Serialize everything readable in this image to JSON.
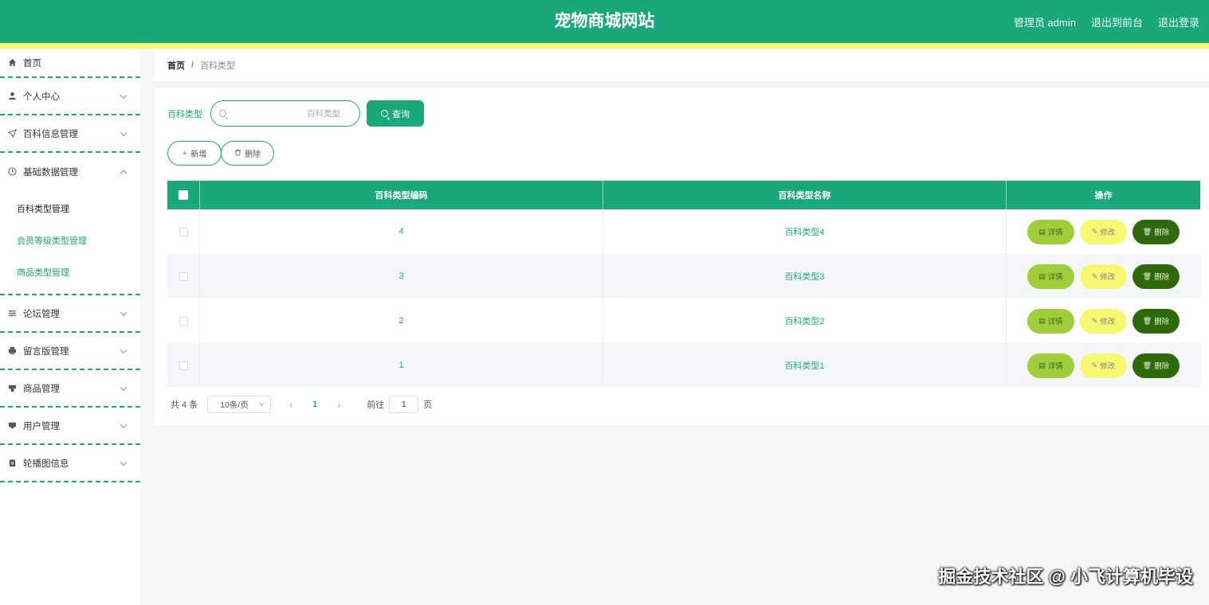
{
  "header": {
    "title": "宠物商城网站",
    "user_label": "管理员 admin",
    "front_link": "退出到前台",
    "logout_link": "退出登录"
  },
  "sidebar": {
    "items": [
      {
        "label": "首页",
        "icon": "home-icon"
      },
      {
        "label": "个人中心",
        "icon": "user-icon"
      },
      {
        "label": "百科信息管理",
        "icon": "send-icon"
      },
      {
        "label": "基础数据管理",
        "icon": "clock-icon",
        "expanded": true,
        "children": [
          "百科类型管理",
          "会员等级类型管理",
          "商品类型管理"
        ],
        "active_child": "百科类型管理"
      },
      {
        "label": "论坛管理",
        "icon": "sliders-icon"
      },
      {
        "label": "留言版管理",
        "icon": "printer-icon"
      },
      {
        "label": "商品管理",
        "icon": "shop-icon"
      },
      {
        "label": "用户管理",
        "icon": "monitor-icon"
      },
      {
        "label": "轮播图信息",
        "icon": "clipboard-icon"
      }
    ]
  },
  "breadcrumb": {
    "home": "首页",
    "separator": "/",
    "current": "百科类型"
  },
  "search": {
    "label": "百科类型",
    "placeholder": "百科类型",
    "value": "",
    "button": "查询"
  },
  "actions": {
    "add": "新增",
    "delete": "删除"
  },
  "table": {
    "columns": [
      "百科类型编码",
      "百科类型名称",
      "操作"
    ],
    "rows": [
      {
        "code": "4",
        "name": "百科类型4"
      },
      {
        "code": "3",
        "name": "百科类型3"
      },
      {
        "code": "2",
        "name": "百科类型2"
      },
      {
        "code": "1",
        "name": "百科类型1"
      }
    ],
    "row_actions": {
      "detail": "详情",
      "edit": "修改",
      "delete": "删除"
    }
  },
  "pagination": {
    "total": "共 4 条",
    "page_size": "10条/页",
    "current_page": "1",
    "goto_label": "前往",
    "goto_value": "1",
    "goto_unit": "页"
  },
  "watermark": "掘金技术社区 @ 小飞计算机毕设",
  "colors": {
    "primary": "#1aa87a",
    "stripe": "#f4f871",
    "detail_btn": "#9fce3a",
    "edit_btn": "#f5f870",
    "delete_btn": "#2e6a0c"
  }
}
